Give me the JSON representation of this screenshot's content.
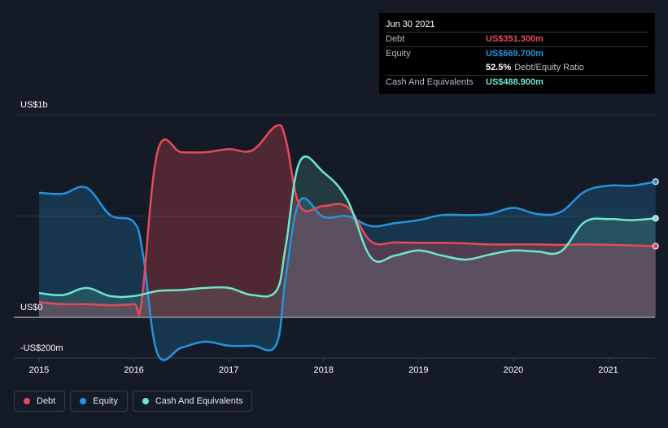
{
  "tooltip": {
    "date": "Jun 30 2021",
    "rows": [
      {
        "name": "Debt",
        "value": "US$351.300m",
        "color": "#e64a58"
      },
      {
        "name": "Equity",
        "value": "US$669.700m",
        "color": "#2394df"
      },
      {
        "name": "",
        "value": "52.5%",
        "extra": "Debt/Equity Ratio",
        "color": "#ffffff"
      },
      {
        "name": "Cash And Equivalents",
        "value": "US$488.900m",
        "color": "#6ee6cf"
      }
    ]
  },
  "legend": [
    {
      "label": "Debt",
      "color": "#e64a58"
    },
    {
      "label": "Equity",
      "color": "#2394df"
    },
    {
      "label": "Cash And Equivalents",
      "color": "#6ee6cf"
    }
  ],
  "chart_data": {
    "type": "area",
    "y_tick_labels": [
      "US$1b",
      "US$0",
      "-US$200m"
    ],
    "ylim": [
      -200,
      1000
    ],
    "x_ticks": [
      2015,
      2016,
      2017,
      2018,
      2019,
      2020,
      2021
    ],
    "xlim": [
      2014.9,
      2021.5
    ],
    "grid": true,
    "legend_position": "bottom-left",
    "series": [
      {
        "name": "Debt",
        "color": "#e64a58",
        "points": [
          [
            2015.0,
            75
          ],
          [
            2015.25,
            65
          ],
          [
            2015.5,
            65
          ],
          [
            2015.75,
            60
          ],
          [
            2016.0,
            65
          ],
          [
            2016.08,
            75
          ],
          [
            2016.25,
            820
          ],
          [
            2016.5,
            815
          ],
          [
            2016.75,
            815
          ],
          [
            2017.0,
            830
          ],
          [
            2017.25,
            825
          ],
          [
            2017.5,
            945
          ],
          [
            2017.6,
            880
          ],
          [
            2017.75,
            550
          ],
          [
            2018.0,
            550
          ],
          [
            2018.25,
            545
          ],
          [
            2018.5,
            375
          ],
          [
            2018.75,
            370
          ],
          [
            2019.0,
            368
          ],
          [
            2019.25,
            368
          ],
          [
            2019.5,
            365
          ],
          [
            2019.75,
            360
          ],
          [
            2020.0,
            360
          ],
          [
            2020.25,
            360
          ],
          [
            2020.5,
            358
          ],
          [
            2020.75,
            360
          ],
          [
            2021.0,
            358
          ],
          [
            2021.25,
            355
          ],
          [
            2021.5,
            351.3
          ]
        ]
      },
      {
        "name": "Equity",
        "color": "#2394df",
        "points": [
          [
            2015.0,
            615
          ],
          [
            2015.25,
            610
          ],
          [
            2015.5,
            640
          ],
          [
            2015.75,
            505
          ],
          [
            2016.0,
            470
          ],
          [
            2016.1,
            300
          ],
          [
            2016.25,
            -180
          ],
          [
            2016.5,
            -150
          ],
          [
            2016.75,
            -120
          ],
          [
            2017.0,
            -140
          ],
          [
            2017.25,
            -140
          ],
          [
            2017.5,
            -135
          ],
          [
            2017.6,
            200
          ],
          [
            2017.75,
            575
          ],
          [
            2018.0,
            495
          ],
          [
            2018.25,
            500
          ],
          [
            2018.5,
            450
          ],
          [
            2018.75,
            465
          ],
          [
            2019.0,
            480
          ],
          [
            2019.25,
            505
          ],
          [
            2019.5,
            505
          ],
          [
            2019.75,
            510
          ],
          [
            2020.0,
            540
          ],
          [
            2020.25,
            510
          ],
          [
            2020.5,
            520
          ],
          [
            2020.75,
            620
          ],
          [
            2021.0,
            650
          ],
          [
            2021.25,
            650
          ],
          [
            2021.5,
            669.7
          ]
        ]
      },
      {
        "name": "Cash And Equivalents",
        "color": "#6ee6cf",
        "points": [
          [
            2015.0,
            120
          ],
          [
            2015.25,
            110
          ],
          [
            2015.5,
            145
          ],
          [
            2015.75,
            105
          ],
          [
            2016.0,
            105
          ],
          [
            2016.25,
            130
          ],
          [
            2016.5,
            135
          ],
          [
            2016.75,
            145
          ],
          [
            2017.0,
            145
          ],
          [
            2017.25,
            110
          ],
          [
            2017.5,
            130
          ],
          [
            2017.6,
            350
          ],
          [
            2017.75,
            770
          ],
          [
            2018.0,
            715
          ],
          [
            2018.25,
            580
          ],
          [
            2018.5,
            295
          ],
          [
            2018.75,
            305
          ],
          [
            2019.0,
            330
          ],
          [
            2019.25,
            305
          ],
          [
            2019.5,
            285
          ],
          [
            2019.75,
            310
          ],
          [
            2020.0,
            330
          ],
          [
            2020.25,
            325
          ],
          [
            2020.5,
            325
          ],
          [
            2020.75,
            470
          ],
          [
            2021.0,
            485
          ],
          [
            2021.25,
            480
          ],
          [
            2021.5,
            488.9
          ]
        ]
      }
    ]
  }
}
